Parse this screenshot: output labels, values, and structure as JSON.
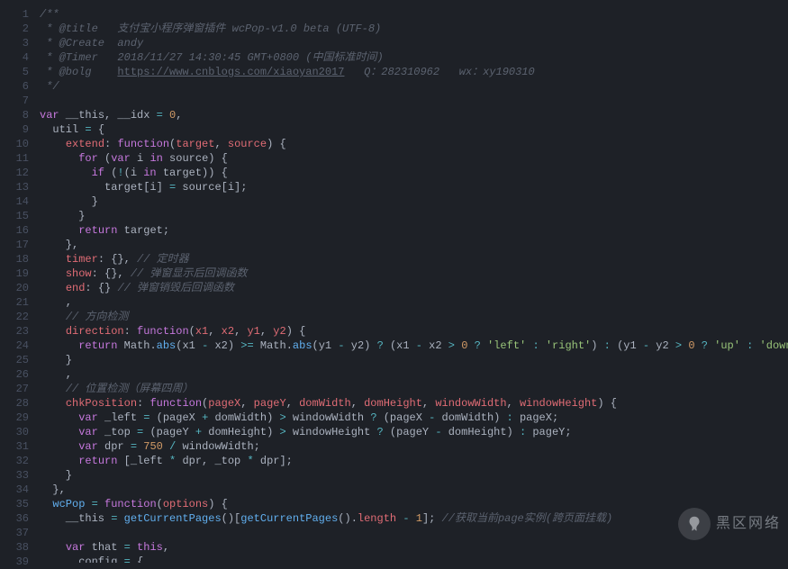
{
  "watermark": {
    "text": "黑区网络"
  },
  "lines": {
    "l1": [
      {
        "c": "cm",
        "t": "/**"
      }
    ],
    "l2": [
      {
        "c": "cm",
        "t": " * @title   支付宝小程序弹窗插件 wcPop-v1.0 beta (UTF-8)"
      }
    ],
    "l3": [
      {
        "c": "cm",
        "t": " * @Create  andy"
      }
    ],
    "l4": [
      {
        "c": "cm",
        "t": " * @Timer   2018/11/27 14:30:45 GMT+0800 (中国标准时间)"
      }
    ],
    "l5": [
      {
        "c": "cm",
        "t": " * @bolg    "
      },
      {
        "c": "lk",
        "t": "https://www.cnblogs.com/xiaoyan2017"
      },
      {
        "c": "cm",
        "t": "   Q：282310962   wx：xy190310"
      }
    ],
    "l6": [
      {
        "c": "cm",
        "t": " */"
      }
    ],
    "l7": [
      {
        "c": "",
        "t": ""
      }
    ],
    "l8": [
      {
        "c": "kw",
        "t": "var"
      },
      {
        "c": "",
        "t": " __this, __idx "
      },
      {
        "c": "op",
        "t": "="
      },
      {
        "c": "",
        "t": " "
      },
      {
        "c": "num",
        "t": "0"
      },
      {
        "c": "",
        "t": ","
      }
    ],
    "l9": [
      {
        "c": "",
        "t": "  util "
      },
      {
        "c": "op",
        "t": "="
      },
      {
        "c": "",
        "t": " {"
      }
    ],
    "l10": [
      {
        "c": "",
        "t": "    "
      },
      {
        "c": "prop",
        "t": "extend"
      },
      {
        "c": "",
        "t": ": "
      },
      {
        "c": "kw",
        "t": "function"
      },
      {
        "c": "",
        "t": "("
      },
      {
        "c": "var",
        "t": "target"
      },
      {
        "c": "",
        "t": ", "
      },
      {
        "c": "var",
        "t": "source"
      },
      {
        "c": "",
        "t": ") {"
      }
    ],
    "l11": [
      {
        "c": "",
        "t": "      "
      },
      {
        "c": "kw",
        "t": "for"
      },
      {
        "c": "",
        "t": " ("
      },
      {
        "c": "kw",
        "t": "var"
      },
      {
        "c": "",
        "t": " i "
      },
      {
        "c": "kw",
        "t": "in"
      },
      {
        "c": "",
        "t": " source) {"
      }
    ],
    "l12": [
      {
        "c": "",
        "t": "        "
      },
      {
        "c": "kw",
        "t": "if"
      },
      {
        "c": "",
        "t": " ("
      },
      {
        "c": "op",
        "t": "!"
      },
      {
        "c": "",
        "t": "(i "
      },
      {
        "c": "kw",
        "t": "in"
      },
      {
        "c": "",
        "t": " target)) {"
      }
    ],
    "l13": [
      {
        "c": "",
        "t": "          target[i] "
      },
      {
        "c": "op",
        "t": "="
      },
      {
        "c": "",
        "t": " source[i];"
      }
    ],
    "l14": [
      {
        "c": "",
        "t": "        }"
      }
    ],
    "l15": [
      {
        "c": "",
        "t": "      }"
      }
    ],
    "l16": [
      {
        "c": "",
        "t": "      "
      },
      {
        "c": "kw",
        "t": "return"
      },
      {
        "c": "",
        "t": " target;"
      }
    ],
    "l17": [
      {
        "c": "",
        "t": "    },"
      }
    ],
    "l18": [
      {
        "c": "",
        "t": "    "
      },
      {
        "c": "prop",
        "t": "timer"
      },
      {
        "c": "",
        "t": ": {}, "
      },
      {
        "c": "cm",
        "t": "// 定时器"
      }
    ],
    "l19": [
      {
        "c": "",
        "t": "    "
      },
      {
        "c": "prop",
        "t": "show"
      },
      {
        "c": "",
        "t": ": {}, "
      },
      {
        "c": "cm",
        "t": "// 弹窗显示后回调函数"
      }
    ],
    "l20": [
      {
        "c": "",
        "t": "    "
      },
      {
        "c": "prop",
        "t": "end"
      },
      {
        "c": "",
        "t": ": {} "
      },
      {
        "c": "cm",
        "t": "// 弹窗销毁后回调函数"
      }
    ],
    "l21": [
      {
        "c": "",
        "t": "    ,"
      }
    ],
    "l22": [
      {
        "c": "",
        "t": "    "
      },
      {
        "c": "cm",
        "t": "// 方向检测"
      }
    ],
    "l23": [
      {
        "c": "",
        "t": "    "
      },
      {
        "c": "prop",
        "t": "direction"
      },
      {
        "c": "",
        "t": ": "
      },
      {
        "c": "kw",
        "t": "function"
      },
      {
        "c": "",
        "t": "("
      },
      {
        "c": "var",
        "t": "x1"
      },
      {
        "c": "",
        "t": ", "
      },
      {
        "c": "var",
        "t": "x2"
      },
      {
        "c": "",
        "t": ", "
      },
      {
        "c": "var",
        "t": "y1"
      },
      {
        "c": "",
        "t": ", "
      },
      {
        "c": "var",
        "t": "y2"
      },
      {
        "c": "",
        "t": ") {"
      }
    ],
    "l24": [
      {
        "c": "",
        "t": "      "
      },
      {
        "c": "kw",
        "t": "return"
      },
      {
        "c": "",
        "t": " Math."
      },
      {
        "c": "fn",
        "t": "abs"
      },
      {
        "c": "",
        "t": "(x1 "
      },
      {
        "c": "op",
        "t": "-"
      },
      {
        "c": "",
        "t": " x2) "
      },
      {
        "c": "op",
        "t": ">="
      },
      {
        "c": "",
        "t": " Math."
      },
      {
        "c": "fn",
        "t": "abs"
      },
      {
        "c": "",
        "t": "(y1 "
      },
      {
        "c": "op",
        "t": "-"
      },
      {
        "c": "",
        "t": " y2) "
      },
      {
        "c": "op",
        "t": "?"
      },
      {
        "c": "",
        "t": " (x1 "
      },
      {
        "c": "op",
        "t": "-"
      },
      {
        "c": "",
        "t": " x2 "
      },
      {
        "c": "op",
        "t": ">"
      },
      {
        "c": "",
        "t": " "
      },
      {
        "c": "num",
        "t": "0"
      },
      {
        "c": "",
        "t": " "
      },
      {
        "c": "op",
        "t": "?"
      },
      {
        "c": "",
        "t": " "
      },
      {
        "c": "str",
        "t": "'left'"
      },
      {
        "c": "",
        "t": " "
      },
      {
        "c": "op",
        "t": ":"
      },
      {
        "c": "",
        "t": " "
      },
      {
        "c": "str",
        "t": "'right'"
      },
      {
        "c": "",
        "t": ") "
      },
      {
        "c": "op",
        "t": ":"
      },
      {
        "c": "",
        "t": " (y1 "
      },
      {
        "c": "op",
        "t": "-"
      },
      {
        "c": "",
        "t": " y2 "
      },
      {
        "c": "op",
        "t": ">"
      },
      {
        "c": "",
        "t": " "
      },
      {
        "c": "num",
        "t": "0"
      },
      {
        "c": "",
        "t": " "
      },
      {
        "c": "op",
        "t": "?"
      },
      {
        "c": "",
        "t": " "
      },
      {
        "c": "str",
        "t": "'up'"
      },
      {
        "c": "",
        "t": " "
      },
      {
        "c": "op",
        "t": ":"
      },
      {
        "c": "",
        "t": " "
      },
      {
        "c": "str",
        "t": "'down'"
      },
      {
        "c": "",
        "t": ")"
      }
    ],
    "l25": [
      {
        "c": "",
        "t": "    }"
      }
    ],
    "l26": [
      {
        "c": "",
        "t": "    ,"
      }
    ],
    "l27": [
      {
        "c": "",
        "t": "    "
      },
      {
        "c": "cm",
        "t": "// 位置检测（屏幕四周）"
      }
    ],
    "l28": [
      {
        "c": "",
        "t": "    "
      },
      {
        "c": "prop",
        "t": "chkPosition"
      },
      {
        "c": "",
        "t": ": "
      },
      {
        "c": "kw",
        "t": "function"
      },
      {
        "c": "",
        "t": "("
      },
      {
        "c": "var",
        "t": "pageX"
      },
      {
        "c": "",
        "t": ", "
      },
      {
        "c": "var",
        "t": "pageY"
      },
      {
        "c": "",
        "t": ", "
      },
      {
        "c": "var",
        "t": "domWidth"
      },
      {
        "c": "",
        "t": ", "
      },
      {
        "c": "var",
        "t": "domHeight"
      },
      {
        "c": "",
        "t": ", "
      },
      {
        "c": "var",
        "t": "windowWidth"
      },
      {
        "c": "",
        "t": ", "
      },
      {
        "c": "var",
        "t": "windowHeight"
      },
      {
        "c": "",
        "t": ") {"
      }
    ],
    "l29": [
      {
        "c": "",
        "t": "      "
      },
      {
        "c": "kw",
        "t": "var"
      },
      {
        "c": "",
        "t": " _left "
      },
      {
        "c": "op",
        "t": "="
      },
      {
        "c": "",
        "t": " (pageX "
      },
      {
        "c": "op",
        "t": "+"
      },
      {
        "c": "",
        "t": " domWidth) "
      },
      {
        "c": "op",
        "t": ">"
      },
      {
        "c": "",
        "t": " windowWidth "
      },
      {
        "c": "op",
        "t": "?"
      },
      {
        "c": "",
        "t": " (pageX "
      },
      {
        "c": "op",
        "t": "-"
      },
      {
        "c": "",
        "t": " domWidth) "
      },
      {
        "c": "op",
        "t": ":"
      },
      {
        "c": "",
        "t": " pageX;"
      }
    ],
    "l30": [
      {
        "c": "",
        "t": "      "
      },
      {
        "c": "kw",
        "t": "var"
      },
      {
        "c": "",
        "t": " _top "
      },
      {
        "c": "op",
        "t": "="
      },
      {
        "c": "",
        "t": " (pageY "
      },
      {
        "c": "op",
        "t": "+"
      },
      {
        "c": "",
        "t": " domHeight) "
      },
      {
        "c": "op",
        "t": ">"
      },
      {
        "c": "",
        "t": " windowHeight "
      },
      {
        "c": "op",
        "t": "?"
      },
      {
        "c": "",
        "t": " (pageY "
      },
      {
        "c": "op",
        "t": "-"
      },
      {
        "c": "",
        "t": " domHeight) "
      },
      {
        "c": "op",
        "t": ":"
      },
      {
        "c": "",
        "t": " pageY;"
      }
    ],
    "l31": [
      {
        "c": "",
        "t": "      "
      },
      {
        "c": "kw",
        "t": "var"
      },
      {
        "c": "",
        "t": " dpr "
      },
      {
        "c": "op",
        "t": "="
      },
      {
        "c": "",
        "t": " "
      },
      {
        "c": "num",
        "t": "750"
      },
      {
        "c": "",
        "t": " "
      },
      {
        "c": "op",
        "t": "/"
      },
      {
        "c": "",
        "t": " windowWidth;"
      }
    ],
    "l32": [
      {
        "c": "",
        "t": "      "
      },
      {
        "c": "kw",
        "t": "return"
      },
      {
        "c": "",
        "t": " [_left "
      },
      {
        "c": "op",
        "t": "*"
      },
      {
        "c": "",
        "t": " dpr, _top "
      },
      {
        "c": "op",
        "t": "*"
      },
      {
        "c": "",
        "t": " dpr];"
      }
    ],
    "l33": [
      {
        "c": "",
        "t": "    }"
      }
    ],
    "l34": [
      {
        "c": "",
        "t": "  },"
      }
    ],
    "l35": [
      {
        "c": "",
        "t": "  "
      },
      {
        "c": "fn",
        "t": "wcPop"
      },
      {
        "c": "",
        "t": " "
      },
      {
        "c": "op",
        "t": "="
      },
      {
        "c": "",
        "t": " "
      },
      {
        "c": "kw",
        "t": "function"
      },
      {
        "c": "",
        "t": "("
      },
      {
        "c": "var",
        "t": "options"
      },
      {
        "c": "",
        "t": ") {"
      }
    ],
    "l36": [
      {
        "c": "",
        "t": "    __this "
      },
      {
        "c": "op",
        "t": "="
      },
      {
        "c": "",
        "t": " "
      },
      {
        "c": "fn",
        "t": "getCurrentPages"
      },
      {
        "c": "",
        "t": "()["
      },
      {
        "c": "fn",
        "t": "getCurrentPages"
      },
      {
        "c": "",
        "t": "()."
      },
      {
        "c": "prop",
        "t": "length"
      },
      {
        "c": "",
        "t": " "
      },
      {
        "c": "op",
        "t": "-"
      },
      {
        "c": "",
        "t": " "
      },
      {
        "c": "num",
        "t": "1"
      },
      {
        "c": "",
        "t": "]; "
      },
      {
        "c": "cm",
        "t": "//获取当前page实例(跨页面挂载)"
      }
    ],
    "l37": [
      {
        "c": "",
        "t": ""
      }
    ],
    "l38": [
      {
        "c": "",
        "t": "    "
      },
      {
        "c": "kw",
        "t": "var"
      },
      {
        "c": "",
        "t": " that "
      },
      {
        "c": "op",
        "t": "="
      },
      {
        "c": "",
        "t": " "
      },
      {
        "c": "kw",
        "t": "this"
      },
      {
        "c": "",
        "t": ","
      }
    ],
    "l39": [
      {
        "c": "",
        "t": "      config "
      },
      {
        "c": "op",
        "t": "="
      },
      {
        "c": "",
        "t": " {"
      }
    ]
  }
}
